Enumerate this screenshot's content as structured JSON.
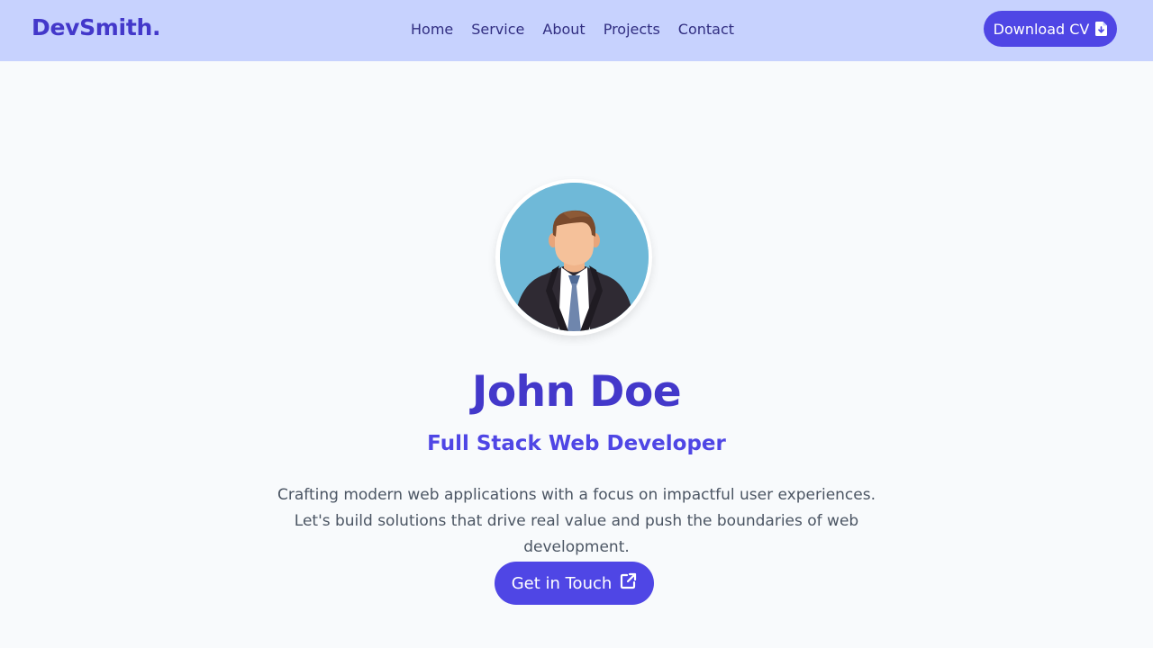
{
  "navbar": {
    "brand": "DevSmith",
    "brand_dot": ".",
    "links": [
      "Home",
      "Service",
      "About",
      "Projects",
      "Contact"
    ],
    "cta_label": "Download CV",
    "cta_icon": "file-download-icon"
  },
  "hero": {
    "avatar_alt": "avatar",
    "name": "John Doe",
    "role": "Full Stack Web Developer",
    "bio": "Crafting modern web applications with a focus on impactful user experiences. Let's build solutions that drive real value and push the boundaries of web development.",
    "cta_label": "Get in Touch",
    "cta_icon": "external-link-icon"
  },
  "colors": {
    "navbar_bg": "#c7d2fe",
    "accent": "#4f46e5",
    "brand": "#4338ca",
    "page_bg": "#f8fafc",
    "body_text": "#4b5563"
  }
}
